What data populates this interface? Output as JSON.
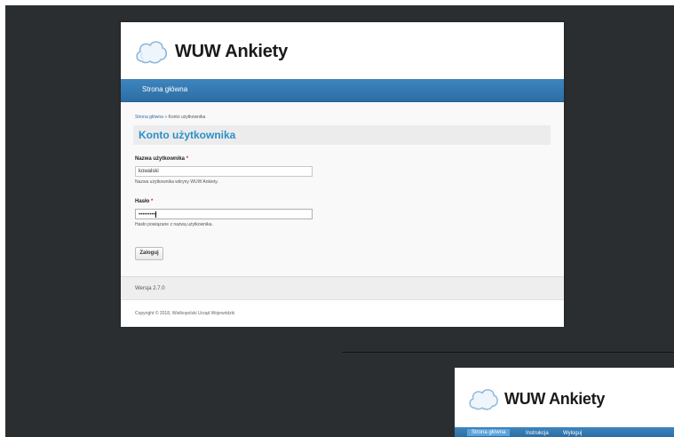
{
  "colors": {
    "accent": "#2c6ea5",
    "title_blue": "#2c8ec7",
    "required": "#e02020",
    "backdrop": "#2b2e30"
  },
  "brand": {
    "title": "WUW Ankiety",
    "icon": "cloud-icon"
  },
  "nav": {
    "items": [
      {
        "label": "Strona główna"
      }
    ]
  },
  "breadcrumb": {
    "home": "Strona główna",
    "separator": " » ",
    "current": "Konto użytkownika"
  },
  "page": {
    "title": "Konto użytkownika"
  },
  "form": {
    "username": {
      "label": "Nazwa użytkownika",
      "required": "*",
      "value": "kowalski",
      "description": "Nazwa użytkownika witryny WUW Ankiety."
    },
    "password": {
      "label": "Hasło",
      "required": "*",
      "value": "•••••••••",
      "description": "Hasło powiązane z nazwą użytkownika."
    },
    "submit_label": "Zaloguj"
  },
  "version": "Wersja 2.7.0",
  "copyright": "Copyright © 2018, Wielkopolski Urząd Wojewódzki",
  "second_window": {
    "brand_title": "WUW Ankiety",
    "nav_items": [
      {
        "label": "Strona główna"
      },
      {
        "label": "Instrukcja"
      },
      {
        "label": "Wyloguj"
      }
    ]
  }
}
